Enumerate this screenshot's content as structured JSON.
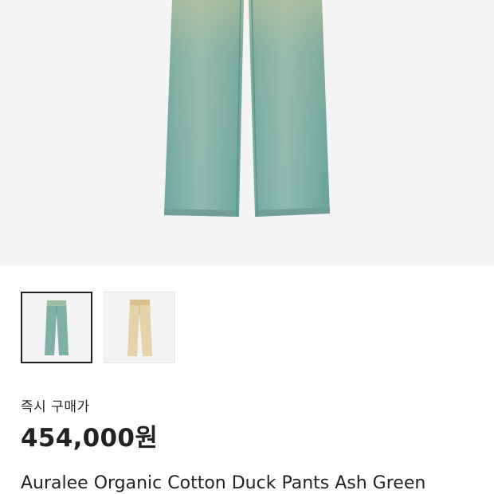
{
  "product": {
    "images": [
      {
        "icon": "pants-ash-green-image",
        "color": "#7fb0a6",
        "selected": true
      },
      {
        "icon": "pants-beige-image",
        "color": "#e6d2a8",
        "selected": false
      }
    ],
    "price_label": "즉시 구매가",
    "price": "454,000원",
    "title": "Auralee Organic Cotton Duck Pants Ash Green"
  }
}
